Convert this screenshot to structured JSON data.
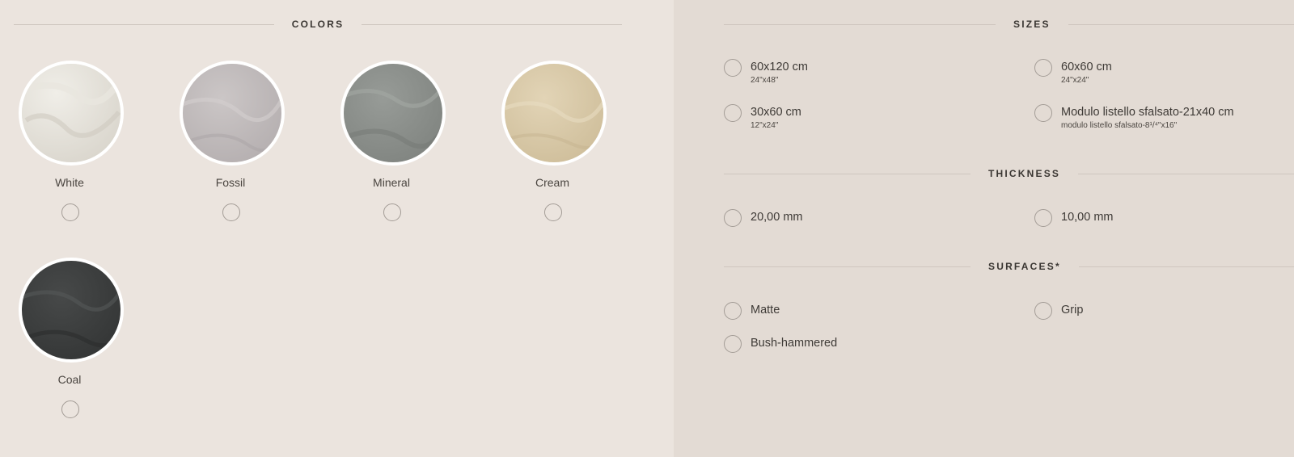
{
  "colors": {
    "heading": "COLORS",
    "items": [
      {
        "label": "White",
        "color": "#e6e3dc"
      },
      {
        "label": "Fossil",
        "color": "#c2bdbd"
      },
      {
        "label": "Mineral",
        "color": "#8d918d"
      },
      {
        "label": "Cream",
        "color": "#dbcbaa"
      },
      {
        "label": "Coal",
        "color": "#3d3f3f"
      }
    ]
  },
  "sizes": {
    "heading": "SIZES",
    "items": [
      {
        "label": "60x120 cm",
        "sub": "24\"x48\""
      },
      {
        "label": "60x60 cm",
        "sub": "24\"x24\""
      },
      {
        "label": "30x60 cm",
        "sub": "12\"x24\""
      },
      {
        "label": "Modulo listello sfalsato-21x40 cm",
        "sub": "modulo listello sfalsato-8¹/⁴\"x16\""
      }
    ]
  },
  "thickness": {
    "heading": "THICKNESS",
    "items": [
      {
        "label": "20,00 mm"
      },
      {
        "label": "10,00 mm"
      }
    ]
  },
  "surfaces": {
    "heading": "SURFACES*",
    "items": [
      {
        "label": "Matte"
      },
      {
        "label": "Grip"
      },
      {
        "label": "Bush-hammered"
      }
    ]
  }
}
